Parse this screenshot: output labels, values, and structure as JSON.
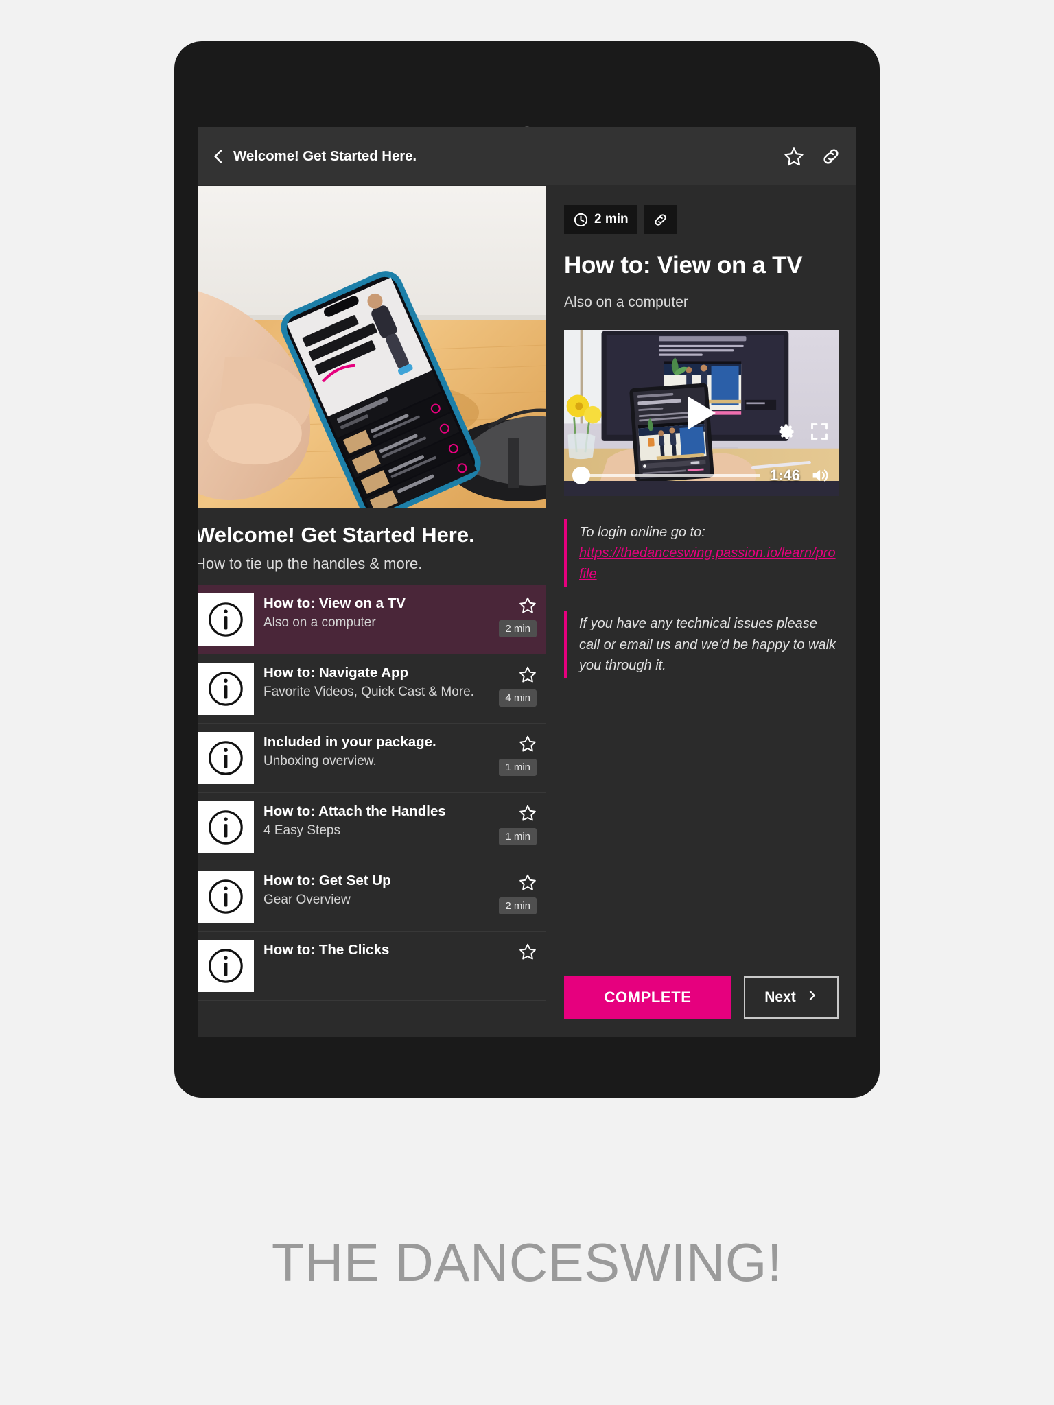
{
  "appbar": {
    "title": "Welcome! Get Started Here.",
    "back_icon": "chevron-left-icon",
    "favorite_icon": "star-icon",
    "share_icon": "link-icon"
  },
  "left_panel": {
    "hero_alt": "hand-holding-phone-photo",
    "title": "Welcome!  Get Started Here.",
    "subtitle": "How to tie up the handles & more.",
    "lessons": [
      {
        "title": "How to: View on a TV",
        "subtitle": "Also on a computer",
        "duration": "2 min",
        "active": true,
        "icon": "info-icon"
      },
      {
        "title": "How to: Navigate App",
        "subtitle": "Favorite Videos, Quick Cast & More.",
        "duration": "4 min",
        "active": false,
        "icon": "info-icon"
      },
      {
        "title": "Included in your package.",
        "subtitle": "Unboxing overview.",
        "duration": "1 min",
        "active": false,
        "icon": "info-icon"
      },
      {
        "title": "How to: Attach the Handles",
        "subtitle": "4 Easy Steps",
        "duration": "1 min",
        "active": false,
        "icon": "info-icon"
      },
      {
        "title": "How to: Get Set Up",
        "subtitle": "Gear Overview",
        "duration": "2 min",
        "active": false,
        "icon": "info-icon"
      },
      {
        "title": "How to: The Clicks",
        "subtitle": "",
        "duration": "",
        "active": false,
        "icon": "info-icon"
      }
    ]
  },
  "right_panel": {
    "duration_chip": "2 min",
    "clock_icon": "clock-icon",
    "link_chip_icon": "link-icon",
    "title": "How to: View on a TV",
    "subtitle": "Also on a computer",
    "video": {
      "play_icon": "play-icon",
      "settings_icon": "gear-icon",
      "fullscreen_icon": "fullscreen-icon",
      "volume_icon": "volume-icon",
      "time": "1:46",
      "progress_percent": 0
    },
    "quotes": [
      {
        "text": "To login online go to:",
        "link": "https://thedanceswing.passion.io/learn/profile"
      },
      {
        "text": "If you have any technical issues please call or email us and we'd be happy to walk you through it.",
        "link": ""
      }
    ],
    "complete_label": "COMPLETE",
    "next_label": "Next",
    "next_icon": "chevron-right-icon"
  },
  "caption": "THE DANCESWING!",
  "colors": {
    "accent_pink": "#e6007e",
    "screen_bg": "#2b2b2b",
    "appbar_bg": "#333333",
    "active_row": "#4a2639",
    "frame": "#1a1a1a",
    "page_bg": "#f2f2f2"
  }
}
